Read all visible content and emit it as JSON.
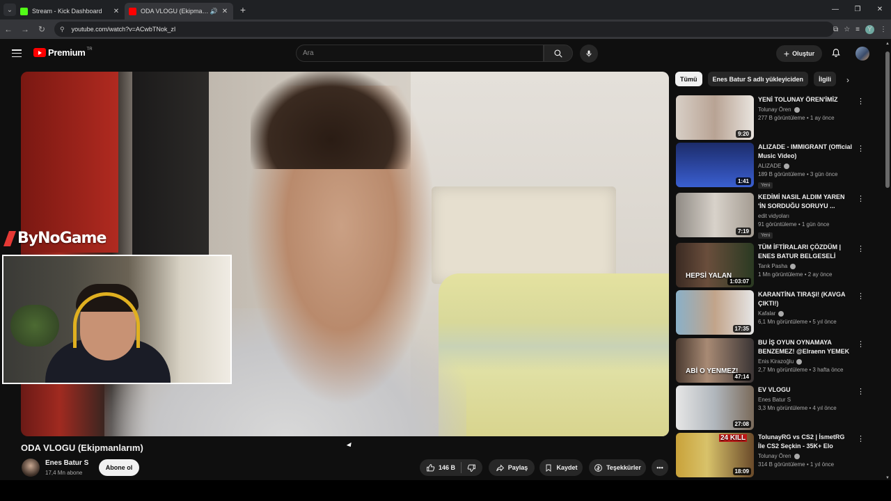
{
  "browser": {
    "tabs": [
      {
        "title": "Stream - Kick Dashboard",
        "favicon_color": "#53fc18",
        "active": false
      },
      {
        "title": "ODA VLOGU (Ekipmanlarım)",
        "favicon_color": "#ff0000",
        "active": true
      }
    ],
    "url": "youtube.com/watch?v=ACwbTNok_zI",
    "profile_initial": "Y"
  },
  "header": {
    "logo_text": "Premium",
    "country_code": "TR",
    "search_placeholder": "Ara",
    "create_label": "Oluştur"
  },
  "overlay": {
    "brand": "ByNoGame"
  },
  "video": {
    "title": "ODA VLOGU (Ekipmanlarım)",
    "channel": "Enes Batur S",
    "subscribers": "17,4 Mn abone",
    "subscribe_label": "Abone ol",
    "likes": "146 B",
    "share_label": "Paylaş",
    "save_label": "Kaydet",
    "thanks_label": "Teşekkürler"
  },
  "sidebar": {
    "chips": [
      "Tümü",
      "Enes Batur S adlı yükleyiciden",
      "İlgili"
    ],
    "items": [
      {
        "title": "YENİ TOLUNAY ÖREN'İMİZ",
        "channel": "Tolunay Ören",
        "verified": true,
        "meta": "277 B görüntüleme • 1 ay önce",
        "duration": "9:20",
        "new": ""
      },
      {
        "title": "ALIZADE - IMMIGRANT (Official Music Video)",
        "channel": "ALIZADE",
        "verified": true,
        "meta": "189 B görüntüleme • 3 gün önce",
        "duration": "1:41",
        "new": "Yeni"
      },
      {
        "title": "KEDİMİ NASIL ALDIM YAREN 'İN SORDUĞU SORUYU ...",
        "channel": "edit vidyoları",
        "verified": false,
        "meta": "91 görüntüleme • 1 gün önce",
        "duration": "7:19",
        "new": "Yeni"
      },
      {
        "title": "TÜM İFTİRALARI ÇÖZDÜM | ENES BATUR BELGESELİ",
        "channel": "Tarık Pasha",
        "verified": true,
        "meta": "1 Mn görüntüleme • 2 ay önce",
        "duration": "1:03:07",
        "new": ""
      },
      {
        "title": "KARANTİNA TIRAŞI! (KAVGA ÇIKTI!)",
        "channel": "Kafalar",
        "verified": true,
        "meta": "6,1 Mn görüntüleme • 5 yıl önce",
        "duration": "17:35",
        "new": ""
      },
      {
        "title": "BU İŞ OYUN OYNAMAYA BENZEMEZ! @Elraenn YEMEK ...",
        "channel": "Enis Kirazoğlu",
        "verified": true,
        "meta": "2,7 Mn görüntüleme • 3 hafta önce",
        "duration": "47:14",
        "new": ""
      },
      {
        "title": "EV VLOGU",
        "channel": "Enes Batur S",
        "verified": false,
        "meta": "3,3 Mn görüntüleme • 4 yıl önce",
        "duration": "27:08",
        "new": ""
      },
      {
        "title": "TolunayRG vs CS2 | İsmetRG İle CS2 Seçkin - 35K+ Elo",
        "channel": "Tolunay Ören",
        "verified": true,
        "meta": "314 B görüntüleme • 1 yıl önce",
        "duration": "18:09",
        "new": ""
      }
    ],
    "thumb_texts": [
      "",
      "",
      "",
      "HEPSİ YALAN",
      "",
      "ABİ O YENMEZ!",
      "",
      "24 KILL"
    ]
  }
}
